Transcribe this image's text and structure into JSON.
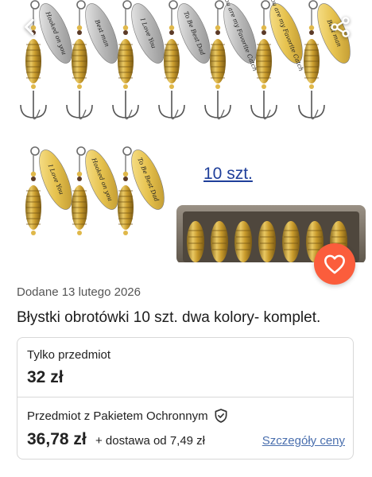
{
  "photo": {
    "qty_caption": "10 szt.",
    "engravings_silver": [
      "Hooked on you",
      "Best man",
      "I Love You",
      "To Be Best Dad",
      "You are my Favorite Catch"
    ],
    "engravings_gold": [
      "You are my Favorite Catch",
      "Best man",
      "I Love You",
      "Hooked on you",
      "To Be Best Dad"
    ]
  },
  "icons": {
    "back": "chevron-left-icon",
    "share": "share-icon",
    "favorite": "heart-icon",
    "protection": "shield-check-icon"
  },
  "colors": {
    "accent": "#fb5d3c",
    "link": "#4a6fae",
    "caption": "#1f3f9a"
  },
  "listing": {
    "added": "Dodane 13 lutego 2026",
    "title": "Błystki obrotówki 10 szt. dwa kolory- komplet."
  },
  "pricing": {
    "item_only_label": "Tylko przedmiot",
    "item_only_price": "32 zł",
    "protected_label": "Przedmiot z Pakietem Ochronnym",
    "protected_price": "36,78 zł",
    "delivery": "+ dostawa od 7,49 zł",
    "details_link": "Szczegóły ceny"
  }
}
